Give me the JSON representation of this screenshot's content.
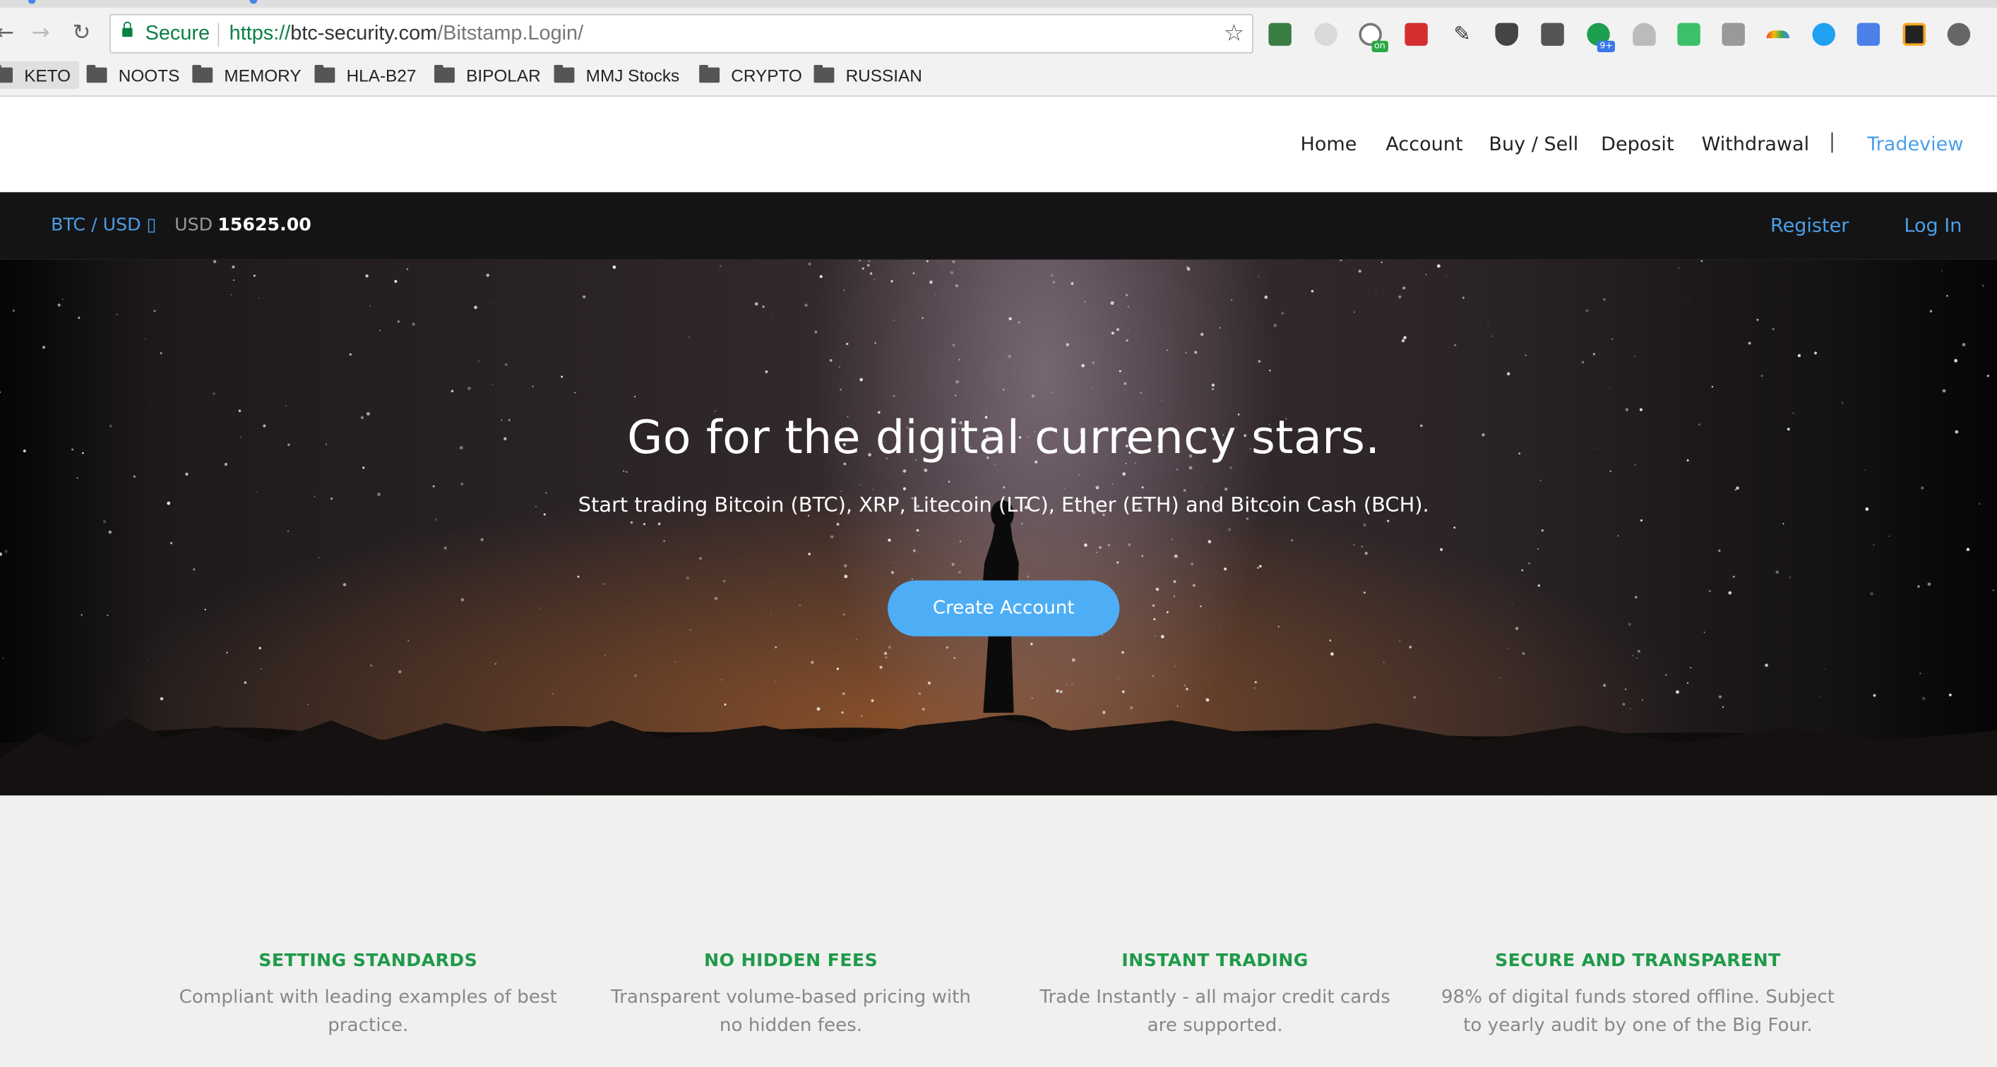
{
  "browser": {
    "security_label": "Secure",
    "url": {
      "scheme": "https://",
      "host": "btc-security.com",
      "path": "/Bitstamp.Login/"
    },
    "extension_badges": {
      "clock": "on",
      "chat": "9+"
    },
    "bookmarks": [
      "KETO",
      "NOOTS",
      "MEMORY",
      "HLA-B27",
      "BIPOLAR",
      "MMJ Stocks",
      "CRYPTO",
      "RUSSIAN"
    ]
  },
  "nav": {
    "items": [
      "Home",
      "Account",
      "Buy / Sell",
      "Deposit",
      "Withdrawal"
    ],
    "separator": "|",
    "highlight_item": "Tradeview"
  },
  "ticker": {
    "pair": "BTC / USD ▯",
    "currency": "USD",
    "price": "15625.00"
  },
  "auth": {
    "register": "Register",
    "login": "Log In"
  },
  "hero": {
    "title": "Go for the digital currency stars.",
    "subtitle": "Start trading Bitcoin (BTC), XRP, Litecoin (LTC), Ether (ETH) and Bitcoin Cash (BCH).",
    "cta": "Create Account"
  },
  "features": [
    {
      "title": "SETTING STANDARDS",
      "text": "Compliant with leading examples of best practice."
    },
    {
      "title": "NO HIDDEN FEES",
      "text": "Transparent volume-based pricing with no hidden fees."
    },
    {
      "title": "INSTANT TRADING",
      "text": "Trade Instantly - all major credit cards are supported."
    },
    {
      "title": "SECURE AND TRANSPARENT",
      "text": "98% of digital funds stored offline. Subject to yearly audit by one of the Big Four."
    }
  ],
  "colors": {
    "accent": "#4a9fe8",
    "button": "#4eaef5",
    "feature_title": "#1f9a4a",
    "secure_green": "#0b8043"
  }
}
